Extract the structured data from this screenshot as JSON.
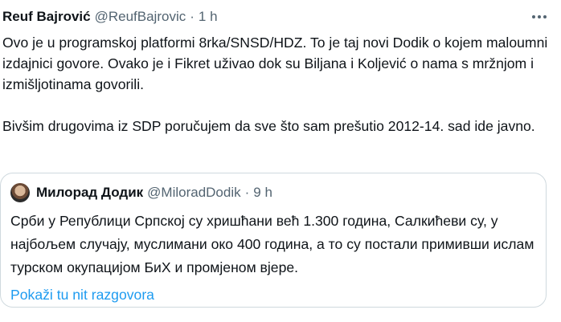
{
  "tweet": {
    "author_name": "Reuf Bajrović",
    "author_handle": "@ReufBajrovic",
    "separator": "·",
    "time": "1 h",
    "paragraph_1": "Ovo je u programskoj platformi 8rka/SNSD/HDZ. To je taj novi Dodik o kojem maloumni izdajnici govore. Ovako je i Fikret uživao dok su Biljana i Koljević o nama s mržnjom i izmišljotinama govorili.",
    "paragraph_2": "Bivšim drugovima iz SDP poručujem da sve što sam prešutio 2012-14. sad ide javno."
  },
  "quoted_tweet": {
    "author_name": "Милорад Додик",
    "author_handle": "@MiloradDodik",
    "separator": "·",
    "time": "9 h",
    "text": "Срби у Републици Српској су хришћани већ 1.300 година, Салкићеви су, у најбољем случају, муслимани око 400 година, а то су постали примивши ислам турском окупацијом БиХ и промјеном вјере.",
    "show_thread_label": "Pokaži tu nit razgovora"
  },
  "icons": {
    "more": "more-horizontal-icon",
    "avatar": "avatar"
  },
  "colors": {
    "text": "#0f1419",
    "secondary": "#536471",
    "link": "#1d9bf0",
    "border": "#cfd9de"
  }
}
